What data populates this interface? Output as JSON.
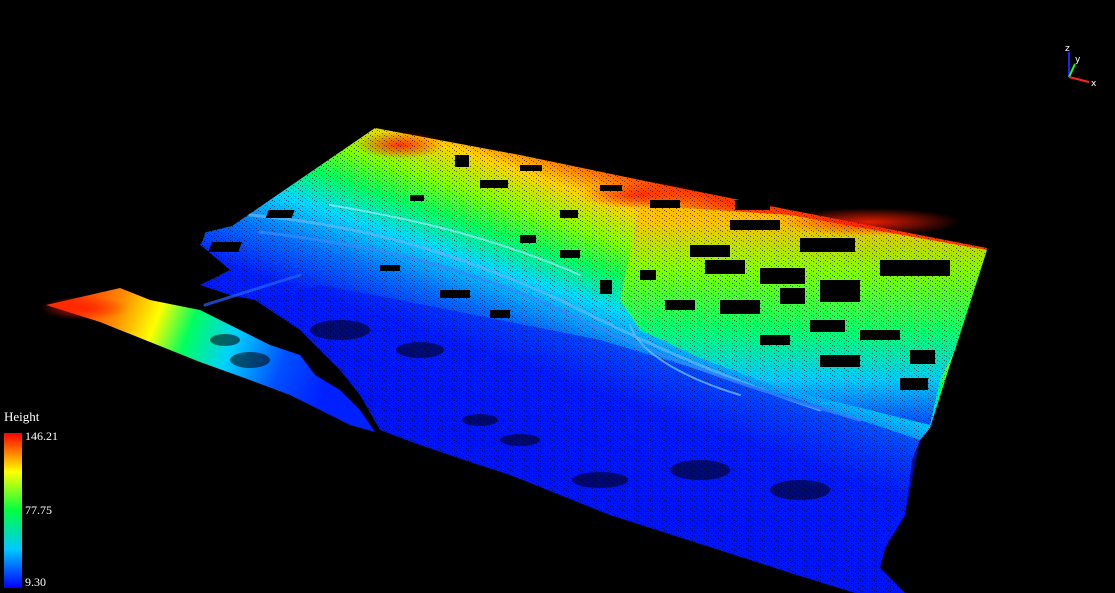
{
  "legend": {
    "title": "Height",
    "max_label": "146.21",
    "mid_label": "77.75",
    "min_label": "9.30",
    "min_value": 9.3,
    "mid_value": 77.75,
    "max_value": 146.21,
    "colormap": [
      "#0000ff",
      "#00c8ff",
      "#00ff40",
      "#ffff00",
      "#ff0000"
    ]
  },
  "axes": {
    "x_label": "x",
    "y_label": "y",
    "z_label": "z",
    "x_color": "#ff2020",
    "y_color": "#20ff20",
    "z_color": "#2020ff"
  },
  "scene": {
    "background": "#000000",
    "content": "point-cloud-terrain"
  }
}
